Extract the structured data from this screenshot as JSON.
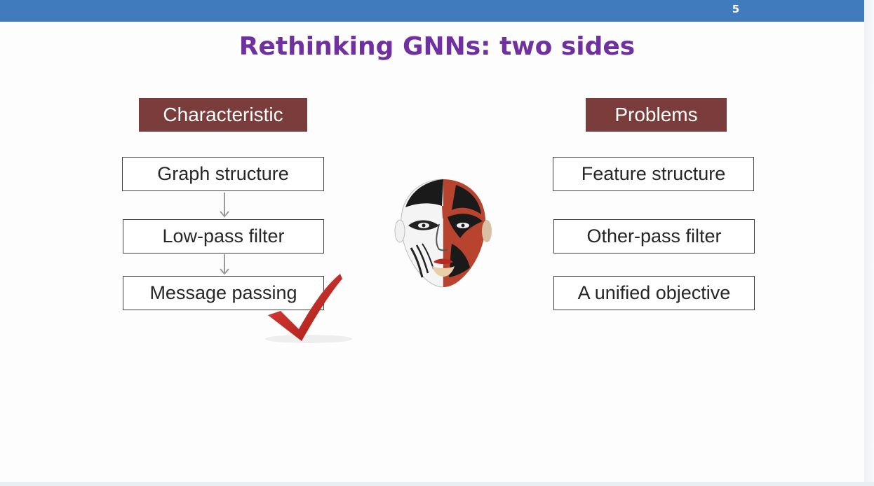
{
  "slide": {
    "page_number": "5",
    "title": "Rethinking GNNs: two sides"
  },
  "left": {
    "header": "Characteristic",
    "items": [
      "Graph structure",
      "Low-pass filter",
      "Message passing"
    ]
  },
  "right": {
    "header": "Problems",
    "items": [
      "Feature structure",
      "Other-pass filter",
      "A unified objective"
    ]
  },
  "icons": {
    "center": "opera-mask-icon",
    "check": "check-mark-icon",
    "arrows": "arrow-down-icon"
  },
  "colors": {
    "topbar": "#3f7bbd",
    "title": "#7030a0",
    "header_bg": "#7a3d3b",
    "check": "#c0241e"
  }
}
